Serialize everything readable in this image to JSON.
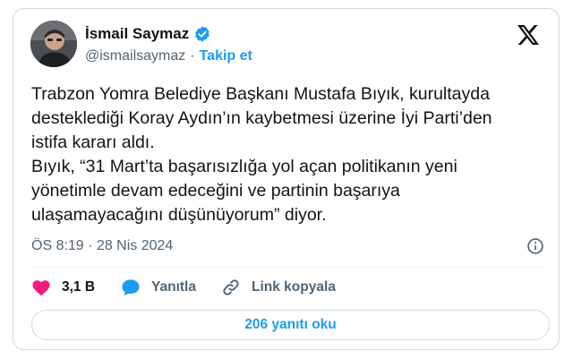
{
  "author": {
    "name": "İsmail Saymaz",
    "handle": "@ismailsaymaz",
    "separator": "·",
    "follow_label": "Takip et",
    "verified": true
  },
  "tweet": {
    "lines": [
      "Trabzon Yomra Belediye Başkanı Mustafa Bıyık, kurultayda",
      "desteklediği Koray Aydın’ın kaybetmesi üzerine İyi Parti’den",
      "istifa kararı aldı.",
      "Bıyık, “31 Mart’ta başarısızlığa yol açan  politikanın yeni",
      "yönetimle devam edeceğini ve partinin başarıya",
      "ulaşamayacağını düşünüyorum” diyor."
    ],
    "timestamp": "ÖS 8:19 · 28 Nis 2024"
  },
  "actions": {
    "like_count": "3,1 B",
    "reply_label": "Yanıtla",
    "copy_link_label": "Link kopyala"
  },
  "read_replies_label": "206 yanıtı oku",
  "icons": {
    "brand": "x-logo-icon",
    "verified": "verified-badge-icon",
    "info": "info-icon",
    "like": "heart-icon",
    "reply": "speech-bubble-icon",
    "copy_link": "link-icon"
  },
  "colors": {
    "accent": "#1d9bf0",
    "like": "#f91880",
    "text_primary": "#0f1419",
    "text_secondary": "#536471",
    "border": "#cfd9de"
  }
}
